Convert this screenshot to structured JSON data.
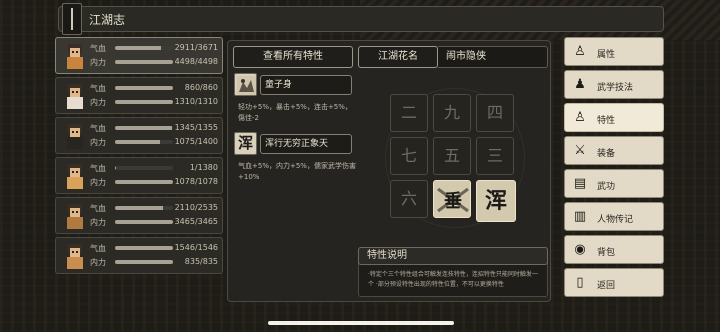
{
  "title": "江湖志",
  "characters": [
    {
      "hp_label": "气血",
      "hp_value": "2911/3671",
      "hp_frac": 0.79,
      "mp_label": "内力",
      "mp_value": "4498/4498",
      "mp_frac": 1.0,
      "selected": true,
      "color": "#c9853e"
    },
    {
      "hp_label": "气血",
      "hp_value": "860/860",
      "hp_frac": 1.0,
      "mp_label": "内力",
      "mp_value": "1310/1310",
      "mp_frac": 1.0,
      "selected": false,
      "color": "#e6ddd0"
    },
    {
      "hp_label": "气血",
      "hp_value": "1345/1355",
      "hp_frac": 0.99,
      "mp_label": "内力",
      "mp_value": "1075/1400",
      "mp_frac": 0.77,
      "selected": false,
      "color": "#2a2420"
    },
    {
      "hp_label": "气血",
      "hp_value": "1/1380",
      "hp_frac": 0.01,
      "mp_label": "内力",
      "mp_value": "1078/1078",
      "mp_frac": 1.0,
      "selected": false,
      "color": "#d9a15a"
    },
    {
      "hp_label": "气血",
      "hp_value": "2110/2535",
      "hp_frac": 0.83,
      "mp_label": "内力",
      "mp_value": "3465/3465",
      "mp_frac": 1.0,
      "selected": false,
      "color": "#b37a3f"
    },
    {
      "hp_label": "气血",
      "hp_value": "1546/1546",
      "hp_frac": 1.0,
      "mp_label": "内力",
      "mp_value": "835/835",
      "mp_frac": 1.0,
      "selected": false,
      "color": "#c98d52"
    }
  ],
  "view_all_traits": "查看所有特性",
  "traits": [
    {
      "name": "童子身",
      "icon": "child-icon",
      "desc": "轻功+5%，暴击+5%，连击+5%，傷佳-2"
    },
    {
      "name": "浑行无穷正象天",
      "icon": "hun-char-icon",
      "icon_char": "浑",
      "desc": "气血+5%，内力+5%，儒家武学伤害+10%"
    }
  ],
  "nickname_label": "江湖花名",
  "nickname_value": "闹市隐侠",
  "grid_slots": [
    "二",
    "九",
    "四",
    "七",
    "五",
    "三",
    "六",
    "",
    "浑"
  ],
  "grid_filled": [
    false,
    false,
    false,
    false,
    false,
    false,
    false,
    true,
    true
  ],
  "desc_title": "特性说明",
  "desc_text": "·特定个三个特性组合可触发连技特性，连招特性只能同时触发一个 ·部分预设特性出现的特性位置，不可以更换特性",
  "menu": [
    {
      "label": "属性",
      "icon": "person-icon",
      "glyph": "♙"
    },
    {
      "label": "武学技法",
      "icon": "martial-icon",
      "glyph": "♟"
    },
    {
      "label": "特性",
      "icon": "trait-icon",
      "glyph": "♙",
      "active": true
    },
    {
      "label": "装备",
      "icon": "sword-icon",
      "glyph": "⚔"
    },
    {
      "label": "武功",
      "icon": "manual-icon",
      "glyph": "▤"
    },
    {
      "label": "人物传记",
      "icon": "book-icon",
      "glyph": "▥"
    },
    {
      "label": "背包",
      "icon": "bag-icon",
      "glyph": "◉"
    },
    {
      "label": "返回",
      "icon": "return-icon",
      "glyph": "▯"
    }
  ]
}
